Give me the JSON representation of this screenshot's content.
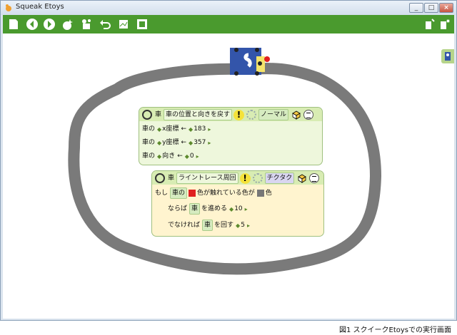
{
  "window": {
    "title": "Squeak Etoys",
    "buttons": [
      "_",
      "□",
      "×"
    ]
  },
  "toolbar": {
    "icons": [
      "paint-icon",
      "back-icon",
      "forward-icon",
      "undo-sparkle-icon",
      "tools-icon",
      "undo-icon",
      "project-icon",
      "fullscreen-icon",
      "help-icon",
      "exit-icon"
    ]
  },
  "script1": {
    "object": "車",
    "name": "車の位置と向きを戻す",
    "mode": "ノーマル",
    "rows": [
      {
        "obj": "車の",
        "prop": "x座標",
        "arrow": "←",
        "value": "183"
      },
      {
        "obj": "車の",
        "prop": "y座標",
        "arrow": "←",
        "value": "357"
      },
      {
        "obj": "車の",
        "prop": "向き",
        "arrow": "←",
        "value": "0"
      }
    ]
  },
  "script2": {
    "object": "車",
    "name": "ライントレース周回",
    "mode": "チクタク",
    "test": {
      "if_label": "もし",
      "obj": "車の",
      "text": "色が触れている色が",
      "end": "色"
    },
    "then": {
      "label": "ならば",
      "obj": "車",
      "action": "を進める",
      "value": "10"
    },
    "else": {
      "label": "でなければ",
      "obj": "車",
      "action": "を回す",
      "value": "5"
    }
  },
  "colors": {
    "toolbar": "#4a9a2e",
    "track": "#7a7a7a",
    "car": "#3355aa",
    "red_swatch": "#e02020",
    "gray_swatch": "#777777"
  },
  "caption": "図1 スクイークEtoysでの実行画面"
}
